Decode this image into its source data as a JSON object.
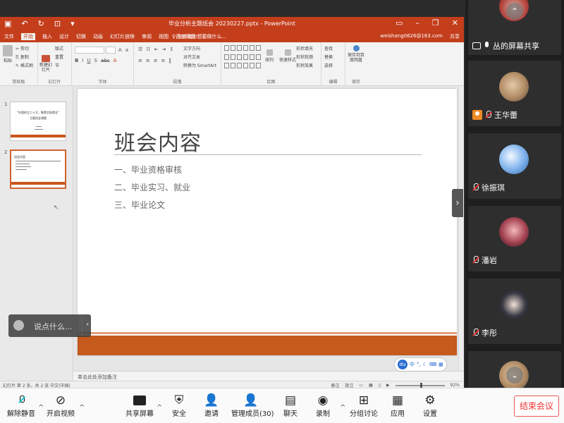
{
  "ppt": {
    "window_title": "毕业分析主题班会 20230227.pptx - PowerPoint",
    "tabs": [
      "文件",
      "开始",
      "插入",
      "设计",
      "切换",
      "动画",
      "幻灯片放映",
      "审阅",
      "视图",
      "百度网盘"
    ],
    "active_tab": "开始",
    "tell_me": "♀ 告诉我你想要做什么...",
    "account": "weishang0626@163.com",
    "share": "共享",
    "ribbon_groups": [
      "剪贴板",
      "幻灯片",
      "字体",
      "段落",
      "绘图",
      "编辑",
      "保存"
    ],
    "ribbon_buttons": {
      "paste": "粘贴",
      "cut": "剪切",
      "copy": "复制",
      "format_painter": "格式刷",
      "new_slide": "新建幻灯片",
      "layout": "版式",
      "reset": "重置",
      "section": "节",
      "arrange": "排列",
      "quick_styles": "快速样式",
      "shape_fill": "形状填充",
      "shape_outline": "形状轮廓",
      "shape_effects": "形状效果",
      "find": "查找",
      "replace": "替换",
      "select": "选择",
      "save_baidu": "保存到百度网盘",
      "text_direction": "文字方向",
      "align_text": "对齐文本",
      "smartart": "转换为 SmartArt"
    },
    "thumbnails": [
      {
        "num": "1",
        "title": "\"牢固树立二十大，聚焦实现就业\"",
        "sub": "主题班会课题"
      },
      {
        "num": "2",
        "title": "班会内容"
      }
    ],
    "slide": {
      "title": "班会内容",
      "items": [
        "一、毕业资格审核",
        "二、毕业实习、就业",
        "三、毕业论文"
      ]
    },
    "notes": "单击此处添加备注",
    "status_left": "幻灯片 第 2 张，共 2 张   中文(中国)",
    "status_notes": "备注",
    "status_comments": "批注",
    "zoom": "92%"
  },
  "ime": {
    "logo": "du",
    "mode": "中"
  },
  "chat": {
    "placeholder": "说点什么..."
  },
  "participants": [
    {
      "name": "丛的屏幕共享",
      "mic": "on",
      "kind": "share"
    },
    {
      "name": "王华蕾",
      "mic": "muted",
      "host": true
    },
    {
      "name": "徐振琪",
      "mic": "muted"
    },
    {
      "name": "潘岩",
      "mic": "muted"
    },
    {
      "name": "李彤",
      "mic": "muted"
    }
  ],
  "toolbar": {
    "unmute": "解除静音",
    "start_video": "开启视频",
    "share_screen": "共享屏幕",
    "security": "安全",
    "invite": "邀请",
    "members": "管理成员(30)",
    "chat": "聊天",
    "record": "录制",
    "breakout": "分组讨论",
    "apps": "应用",
    "settings": "设置",
    "end_meeting": "结束会议"
  },
  "colors": {
    "ppt_accent": "#c43e1c",
    "slide_band": "#c45a1c",
    "end_button": "#e33333"
  }
}
